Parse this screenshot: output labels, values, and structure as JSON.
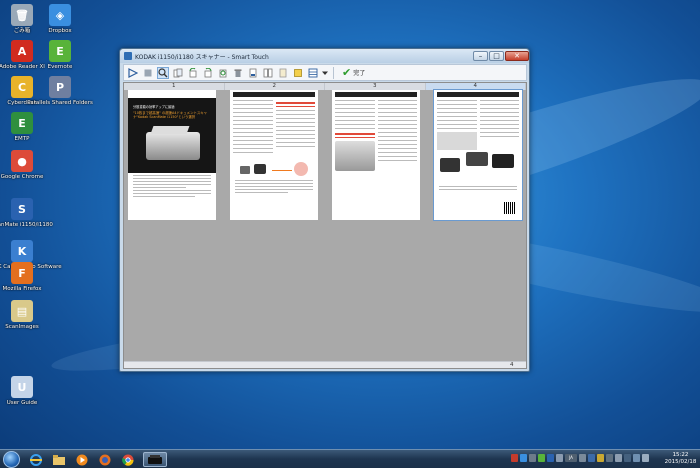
{
  "desktop": {
    "icons": [
      {
        "label": "ごみ箱",
        "glyph": "🗑",
        "color": "#9aa9b8",
        "name": "recycle-bin"
      },
      {
        "label": "Dropbox",
        "glyph": "◈",
        "color": "#3a8fe0",
        "name": "dropbox"
      },
      {
        "label": "Adobe Reader XI",
        "glyph": "A",
        "color": "#d12b1f",
        "name": "adobe-reader"
      },
      {
        "label": "Evernote",
        "glyph": "E",
        "color": "#58b33a",
        "name": "evernote"
      },
      {
        "label": "Cyberduck",
        "glyph": "C",
        "color": "#e8b32a",
        "name": "cyberduck"
      },
      {
        "label": "Parallels Shared Folders",
        "glyph": "P",
        "color": "#6f7fa0",
        "name": "parallels"
      },
      {
        "label": "EMTP",
        "glyph": "E",
        "color": "#2f8f3e",
        "name": "emtp"
      },
      {
        "label": "Google Chrome",
        "glyph": "●",
        "color": "#dd4b39",
        "name": "google-chrome"
      },
      {
        "label": "ScanMate i1150/i1180",
        "glyph": "S",
        "color": "#2a62b0",
        "name": "scanmate"
      },
      {
        "label": "KODAK Capture Pro Software",
        "glyph": "K",
        "color": "#3b7fd0",
        "name": "kodak-capture-pro"
      },
      {
        "label": "Mozilla Firefox",
        "glyph": "F",
        "color": "#e36f1f",
        "name": "firefox"
      },
      {
        "label": "ScanImages",
        "glyph": "▤",
        "color": "#d9c98a",
        "name": "scanimages"
      },
      {
        "label": "User Guide",
        "glyph": "U",
        "color": "#c4d4e8",
        "name": "user-guide"
      }
    ]
  },
  "window": {
    "title": "KODAK i1150/i1180 スキャナー - Smart Touch",
    "minimize": "–",
    "maximize": "□",
    "close": "✕",
    "toolbar": {
      "done_label": "完了"
    },
    "page_numbers": [
      "1",
      "2",
      "3",
      "4"
    ],
    "pages": [
      {
        "heading": "分散書類の効率アップに最適",
        "title": "\"10枚まで超高速\" の超速A4ドキュメントスキャナ\"Kodak ScanMate i1150\"という選択"
      },
      {
        "heading": "",
        "title": ""
      },
      {
        "heading": "",
        "title": ""
      },
      {
        "heading": "",
        "title": ""
      }
    ],
    "status_page": "4"
  },
  "taskbar": {
    "clock_time": "15:22",
    "clock_date": "2015/02/18",
    "lang": "JA"
  }
}
